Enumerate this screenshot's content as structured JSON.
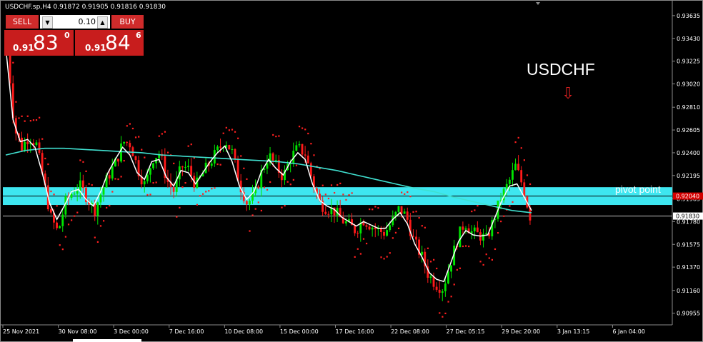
{
  "header": {
    "title": "USDCHF.sp,H4  0.91872 0.91905 0.91816 0.91830"
  },
  "trade_panel": {
    "sell_label": "SELL",
    "buy_label": "BUY",
    "lot": "0.10",
    "sell_small": "0.91",
    "sell_big": "83",
    "sell_sup": "0",
    "buy_small": "0.91",
    "buy_big": "84",
    "buy_sup": "6"
  },
  "annotations": {
    "symbol": "USDCHF",
    "pivot_label": "pivot point",
    "arrow": "⇩"
  },
  "colors": {
    "bull": "#00e600",
    "bear": "#ff1a1a",
    "pivot_band": "#3ee6f0",
    "ma_long": "#40e0d0",
    "ma_short": "#ffffff",
    "psar": "#ff2020"
  },
  "chart_data": {
    "type": "candlestick",
    "ylim": [
      0.9085,
      0.9375
    ],
    "y_ticks": [
      "0.93635",
      "0.93430",
      "0.93225",
      "0.93020",
      "0.92810",
      "0.92605",
      "0.92400",
      "0.92195",
      "0.91985",
      "0.91780",
      "0.91575",
      "0.91370",
      "0.91160",
      "0.90955"
    ],
    "x_labels": [
      "25 Nov 2021",
      "30 Nov 08:00",
      "3 Dec 00:00",
      "7 Dec 16:00",
      "10 Dec 08:00",
      "15 Dec 00:00",
      "17 Dec 16:00",
      "22 Dec 08:00",
      "27 Dec 05:15",
      "29 Dec 20:00",
      "3 Jan 13:15",
      "6 Jan 04:00"
    ],
    "current_price": "0.91830",
    "pivot_price_label": "0.92040",
    "pivot_zone": [
      0.9193,
      0.9209
    ],
    "close_path": [
      0.9335,
      0.9262,
      0.9245,
      0.9255,
      0.9248,
      0.9215,
      0.9182,
      0.9168,
      0.9195,
      0.9205,
      0.921,
      0.92,
      0.9188,
      0.9205,
      0.922,
      0.9232,
      0.925,
      0.9248,
      0.9225,
      0.921,
      0.9235,
      0.924,
      0.9215,
      0.9205,
      0.9228,
      0.9225,
      0.921,
      0.9222,
      0.9232,
      0.9242,
      0.9252,
      0.924,
      0.9212,
      0.9195,
      0.92,
      0.9222,
      0.9238,
      0.9228,
      0.9218,
      0.9235,
      0.9244,
      0.924,
      0.9215,
      0.9195,
      0.919,
      0.9188,
      0.918,
      0.9175,
      0.917,
      0.918,
      0.9175,
      0.917,
      0.9168,
      0.9178,
      0.919,
      0.9182,
      0.916,
      0.9148,
      0.913,
      0.9122,
      0.9118,
      0.914,
      0.9162,
      0.9178,
      0.9168,
      0.9166,
      0.9162,
      0.918,
      0.92,
      0.9212,
      0.9228,
      0.921,
      0.9183
    ],
    "ma_long": [
      0.9238,
      0.9242,
      0.9244,
      0.9244,
      0.9243,
      0.9242,
      0.9241,
      0.924,
      0.9238,
      0.9237,
      0.9236,
      0.9235,
      0.9234,
      0.9233,
      0.9232,
      0.923,
      0.9227,
      0.9224,
      0.922,
      0.9216,
      0.9212,
      0.9208,
      0.9205,
      0.92,
      0.9196,
      0.9192,
      0.9188,
      0.9186
    ],
    "ma_short": [
      0.9335,
      0.927,
      0.925,
      0.9252,
      0.9245,
      0.9222,
      0.9195,
      0.918,
      0.9192,
      0.9205,
      0.9207,
      0.9198,
      0.9192,
      0.9205,
      0.9222,
      0.9234,
      0.9245,
      0.9238,
      0.9222,
      0.9216,
      0.9232,
      0.9234,
      0.9218,
      0.921,
      0.9224,
      0.9222,
      0.9212,
      0.9222,
      0.9232,
      0.924,
      0.9246,
      0.9232,
      0.921,
      0.9198,
      0.9205,
      0.9223,
      0.9234,
      0.9226,
      0.922,
      0.9232,
      0.924,
      0.9234,
      0.9212,
      0.9197,
      0.9192,
      0.9189,
      0.9182,
      0.9178,
      0.9174,
      0.9178,
      0.9175,
      0.9172,
      0.9172,
      0.918,
      0.9186,
      0.9176,
      0.9158,
      0.9146,
      0.9132,
      0.9126,
      0.9124,
      0.9142,
      0.916,
      0.917,
      0.9166,
      0.9165,
      0.9166,
      0.9182,
      0.9198,
      0.921,
      0.9212,
      0.92,
      0.9188
    ]
  }
}
